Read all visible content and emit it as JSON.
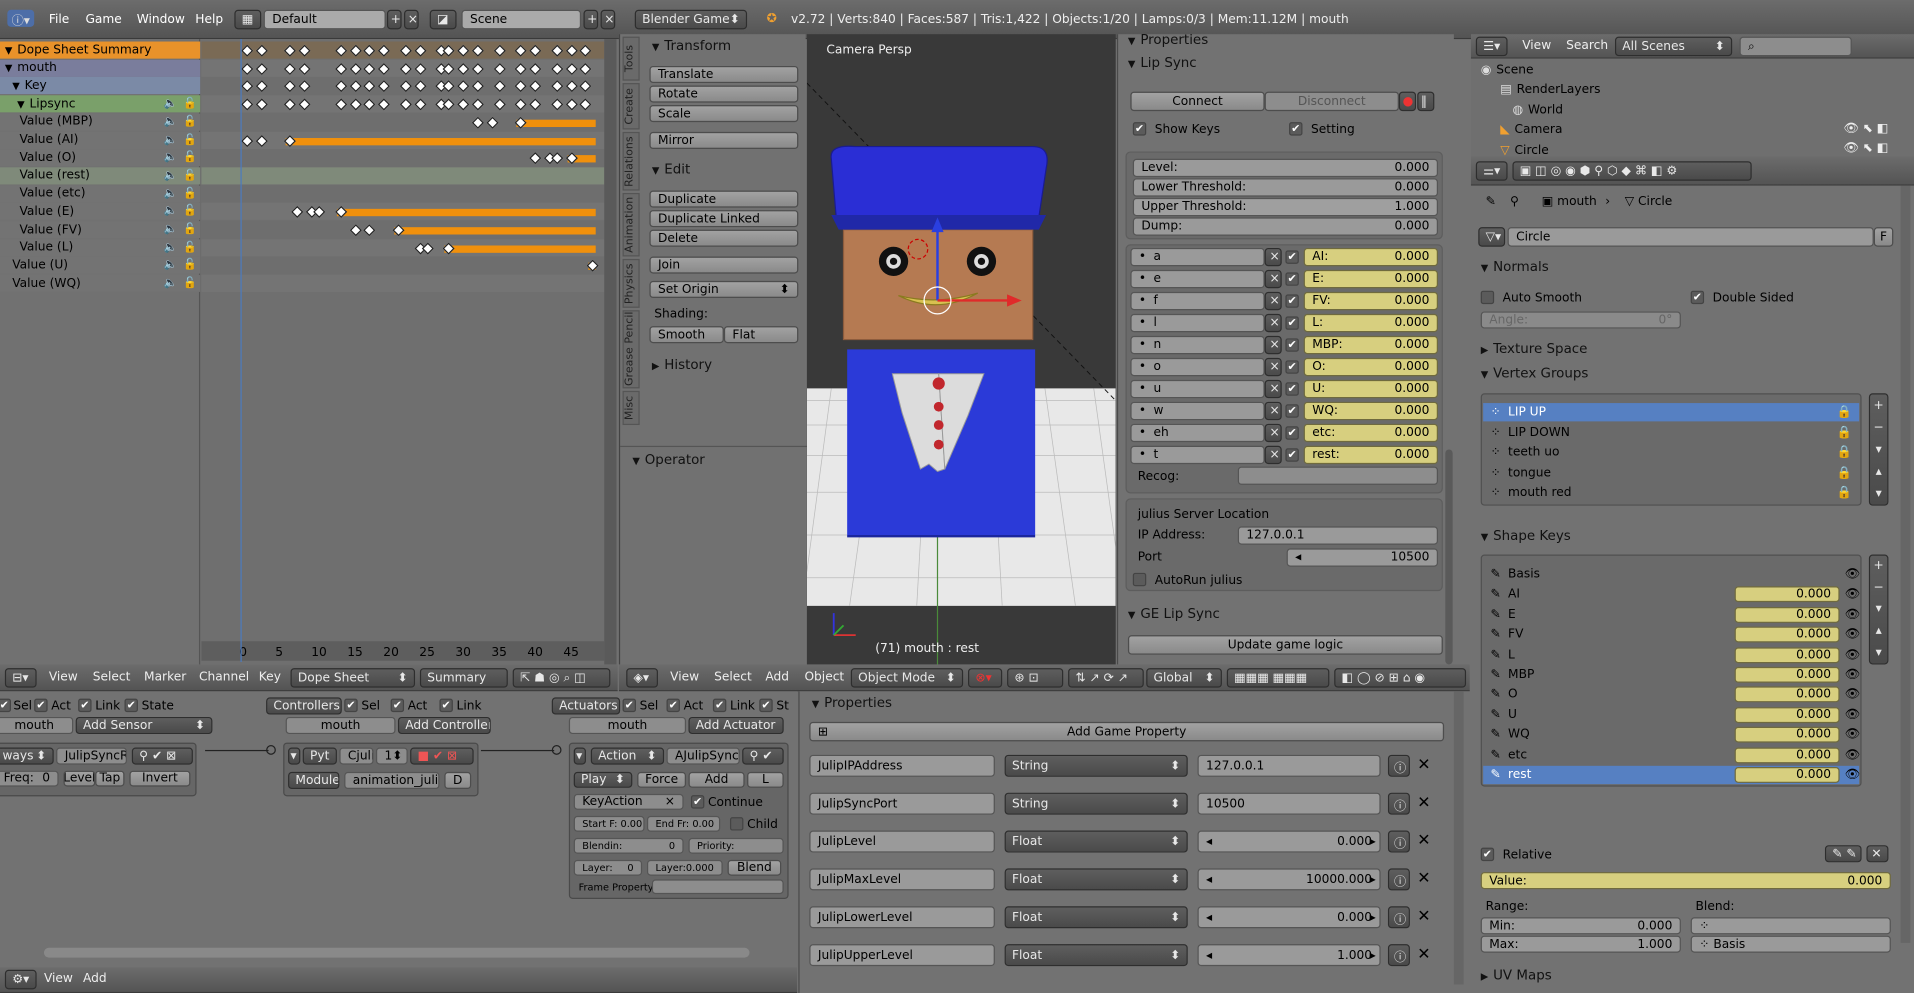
{
  "topbar": {
    "menus": [
      "File",
      "Game",
      "Window",
      "Help"
    ],
    "layout": "Default",
    "scene": "Scene",
    "engine": "Blender Game",
    "stats": "v2.72 | Verts:840 | Faces:587 | Tris:1,422 | Objects:1/20 | Lamps:0/3 | Mem:11.12M | mouth"
  },
  "dopesheet": {
    "channels": [
      "Dope Sheet Summary",
      "mouth",
      "Key",
      "Lipsync",
      "Value (MBP)",
      "Value (AI)",
      "Value (O)",
      "Value (rest)",
      "Value (etc)",
      "Value (E)",
      "Value (FV)",
      "Value (L)",
      "Value (U)",
      "Value (WQ)"
    ],
    "ticks": [
      "0",
      "5",
      "10",
      "15",
      "20",
      "25",
      "30",
      "35",
      "40",
      "45"
    ],
    "footer": {
      "menus": [
        "View",
        "Select",
        "Marker",
        "Channel",
        "Key"
      ],
      "mode": "Dope Sheet",
      "summary": "Summary"
    }
  },
  "tools": {
    "tabs": [
      "Tools",
      "Create",
      "Relations",
      "Animation",
      "Physics",
      "Grease Pencil",
      "Misc"
    ],
    "transform_title": "Transform",
    "transform": [
      "Translate",
      "Rotate",
      "Scale"
    ],
    "mirror": "Mirror",
    "edit_title": "Edit",
    "edit": [
      "Duplicate",
      "Duplicate Linked",
      "Delete"
    ],
    "join": "Join",
    "set_origin": "Set Origin",
    "shading_label": "Shading:",
    "smooth": "Smooth",
    "flat": "Flat",
    "history": "History",
    "operator": "Operator"
  },
  "viewport": {
    "label": "Camera Persp",
    "status": "(71) mouth : rest",
    "footer": {
      "menus": [
        "View",
        "Select",
        "Add",
        "Object"
      ],
      "mode": "Object Mode",
      "orient": "Global"
    }
  },
  "properties": {
    "title": "Properties",
    "lipsync_title": "Lip Sync",
    "connect": "Connect",
    "disconnect": "Disconnect",
    "show_keys": "Show Keys",
    "setting": "Setting",
    "levels": [
      {
        "label": "Level:",
        "value": "0.000"
      },
      {
        "label": "Lower Threshold:",
        "value": "0.000"
      },
      {
        "label": "Upper Threshold:",
        "value": "1.000"
      },
      {
        "label": "Dump:",
        "value": "0.000"
      }
    ],
    "phonemes": [
      {
        "key": "a",
        "shape": "AI:",
        "value": "0.000"
      },
      {
        "key": "e",
        "shape": "E:",
        "value": "0.000"
      },
      {
        "key": "f",
        "shape": "FV:",
        "value": "0.000"
      },
      {
        "key": "l",
        "shape": "L:",
        "value": "0.000"
      },
      {
        "key": "n",
        "shape": "MBP:",
        "value": "0.000"
      },
      {
        "key": "o",
        "shape": "O:",
        "value": "0.000"
      },
      {
        "key": "u",
        "shape": "U:",
        "value": "0.000"
      },
      {
        "key": "w",
        "shape": "WQ:",
        "value": "0.000"
      },
      {
        "key": "eh",
        "shape": "etc:",
        "value": "0.000"
      },
      {
        "key": "t",
        "shape": "rest:",
        "value": "0.000"
      }
    ],
    "recog": "Recog:",
    "server_title": "julius Server Location",
    "ip_label": "IP Address:",
    "ip": "127.0.0.1",
    "port_label": "Port",
    "port": "10500",
    "autorun": "AutoRun julius",
    "ge_title": "GE Lip Sync",
    "update": "Update game logic"
  },
  "logic": {
    "sensors": {
      "filters": [
        "Sel",
        "Act",
        "Link",
        "State"
      ],
      "object": "mouth",
      "add": "Add Sensor",
      "type": "ways",
      "name": "JulipSyncRe...",
      "freq": "Freq:",
      "freq_val": "0",
      "level": "Level",
      "tap": "Tap",
      "invert": "Invert"
    },
    "controllers": {
      "label": "Controllers",
      "filters": [
        "Sel",
        "Act",
        "Link"
      ],
      "object": "mouth",
      "add": "Add Controller",
      "type": "Pyt",
      "name": "Cjuli",
      "num": "1",
      "module": "Module",
      "module_val": "animation_julius_to..."
    },
    "actuators": {
      "label": "Actuators",
      "filters": [
        "Sel",
        "Act",
        "Link",
        "St"
      ],
      "object": "mouth",
      "add": "Add Actuator",
      "type": "Action",
      "name": "AJulipSyncRe...",
      "play": "Play",
      "force": "Force",
      "add2": "Add",
      "keyaction": "KeyAction",
      "continue": "Continue",
      "start": "Start F: 0.00",
      "end": "End Fr: 0.00",
      "child": "Child",
      "blendin": "Blendin:",
      "blendin_val": "0",
      "priority": "Priority:",
      "layer": "Layer:",
      "layer_val": "0",
      "layerw": "Layer:0.000",
      "blend": "Blend",
      "frame_prop": "Frame Property:"
    },
    "footer": {
      "menus": [
        "View",
        "Add"
      ]
    }
  },
  "game_props": {
    "title": "Properties",
    "add": "Add Game Property",
    "rows": [
      {
        "name": "JulipIPAddress",
        "type": "String",
        "value": "127.0.0.1"
      },
      {
        "name": "JulipSyncPort",
        "type": "String",
        "value": "10500"
      },
      {
        "name": "JulipLevel",
        "type": "Float",
        "value": "0.000"
      },
      {
        "name": "JulipMaxLevel",
        "type": "Float",
        "value": "10000.000"
      },
      {
        "name": "JulipLowerLevel",
        "type": "Float",
        "value": "0.000"
      },
      {
        "name": "JulipUpperLevel",
        "type": "Float",
        "value": "1.000"
      }
    ]
  },
  "outliner": {
    "menus": [
      "View",
      "Search"
    ],
    "scope": "All Scenes",
    "items": [
      "Scene",
      "RenderLayers",
      "World",
      "Camera",
      "Circle"
    ]
  },
  "data_props": {
    "breadcrumb": [
      "mouth",
      "Circle"
    ],
    "mesh_name": "Circle",
    "f": "F",
    "normals": "Normals",
    "auto_smooth": "Auto Smooth",
    "double_sided": "Double Sided",
    "angle": "Angle:",
    "angle_val": "0°",
    "texture_space": "Texture Space",
    "vertex_groups": "Vertex Groups",
    "vgroups": [
      "LIP UP",
      "LIP DOWN",
      "teeth uo",
      "tongue",
      "mouth red"
    ],
    "shape_keys_title": "Shape Keys",
    "shape_keys": [
      {
        "name": "Basis",
        "value": ""
      },
      {
        "name": "AI",
        "value": "0.000"
      },
      {
        "name": "E",
        "value": "0.000"
      },
      {
        "name": "FV",
        "value": "0.000"
      },
      {
        "name": "L",
        "value": "0.000"
      },
      {
        "name": "MBP",
        "value": "0.000"
      },
      {
        "name": "O",
        "value": "0.000"
      },
      {
        "name": "U",
        "value": "0.000"
      },
      {
        "name": "WQ",
        "value": "0.000"
      },
      {
        "name": "etc",
        "value": "0.000"
      },
      {
        "name": "rest",
        "value": "0.000"
      }
    ],
    "relative": "Relative",
    "value_label": "Value:",
    "value": "0.000",
    "range": "Range:",
    "blend": "Blend:",
    "min_label": "Min:",
    "min": "0.000",
    "max_label": "Max:",
    "max": "1.000",
    "blend_val": "Basis",
    "uv_maps": "UV Maps"
  },
  "colors": {
    "orange": "#f0900c",
    "select_blue": "#5680c2",
    "yellow": "#d7cf7f",
    "panel": "#727272"
  }
}
